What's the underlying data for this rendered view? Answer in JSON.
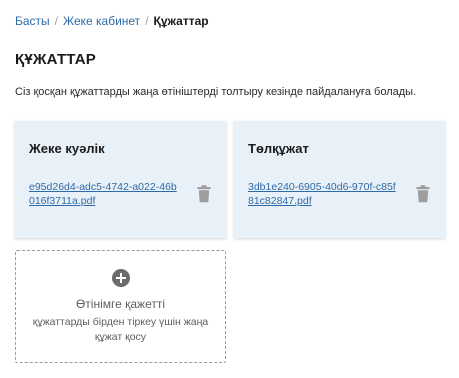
{
  "breadcrumb": {
    "items": [
      "Басты",
      "Жеке кабинет"
    ],
    "current": "Құжаттар",
    "separator": "/"
  },
  "page": {
    "title": "ҚҰЖАТТАР",
    "subtitle": "Сіз қосқан құжаттарды жаңа өтініштерді толтыру кезінде пайдалануға болады."
  },
  "documents": [
    {
      "title": "Жеке куәлік",
      "file": "e95d26d4-adc5-4742-a022-46b016f3711a.pdf",
      "icon": "trash-icon"
    },
    {
      "title": "Төлқұжат",
      "file": "3db1e240-6905-40d6-970f-c85f81c82847.pdf",
      "icon": "trash-icon"
    }
  ],
  "add_card": {
    "icon": "plus-circle-icon",
    "title": "Өтінімге қажетті",
    "description": "құжаттарды бірден тіркеу үшін жаңа құжат қосу"
  },
  "colors": {
    "link": "#2f6aa8",
    "card_bg": "#e9f1f8",
    "icon_gray": "#9e9e9e",
    "add_icon": "#6b6b6b"
  }
}
